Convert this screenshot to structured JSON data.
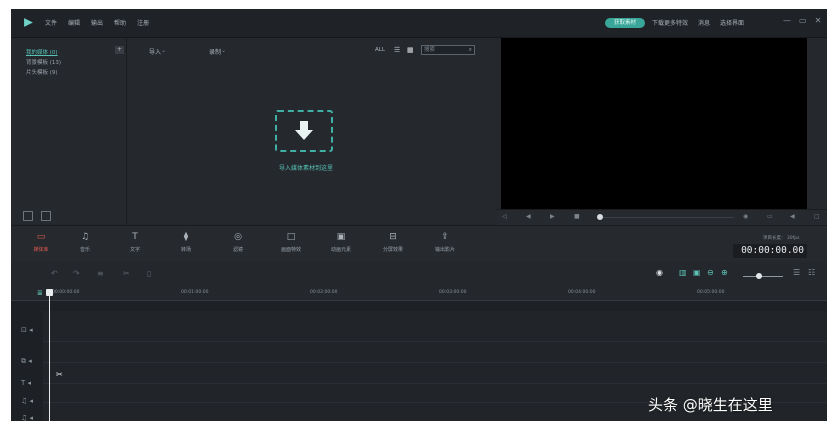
{
  "menu": [
    "文件",
    "编辑",
    "输出",
    "帮助",
    "注册"
  ],
  "topbar": {
    "pill": "获取素材",
    "links": [
      "下载更多特效",
      "消息",
      "选择界面"
    ],
    "window_controls": [
      "—",
      "▭",
      "✕"
    ]
  },
  "library": {
    "sidebar": [
      "我的媒体 (0)",
      "背景模板 (13)",
      "片头模板 (9)"
    ],
    "add_label": "+",
    "import_label": "导入",
    "record_label": "录制",
    "view_all": "ALL",
    "search_placeholder": "搜索",
    "drop_label": "导入媒体素材到这里"
  },
  "tools": [
    {
      "label": "媒体库",
      "icon": "▭",
      "active": true
    },
    {
      "label": "音乐",
      "icon": "♫",
      "active": false
    },
    {
      "label": "文字",
      "icon": "T",
      "active": false
    },
    {
      "label": "转场",
      "icon": "⧫",
      "active": false
    },
    {
      "label": "滤镜",
      "icon": "◎",
      "active": false
    },
    {
      "label": "画面特效",
      "icon": "□",
      "active": false
    },
    {
      "label": "动画元素",
      "icon": "▣",
      "active": false
    },
    {
      "label": "分屏效果",
      "icon": "⊟",
      "active": false
    },
    {
      "label": "输出影片",
      "icon": "⇪",
      "active": false
    }
  ],
  "timecode": {
    "caption": "项目长度： 30fps",
    "value": "00:00:00.00"
  },
  "ruler_ticks": [
    "00:00:00:00",
    "00:01:00:00",
    "00:02:00:00",
    "00:03:00:00",
    "00:04:00:00",
    "00:05:00:00"
  ],
  "watermark": "头条 @晓生在这里",
  "colors": {
    "accent": "#3fb0a3",
    "active_tool": "#e05a4e",
    "preview": "#000000"
  }
}
